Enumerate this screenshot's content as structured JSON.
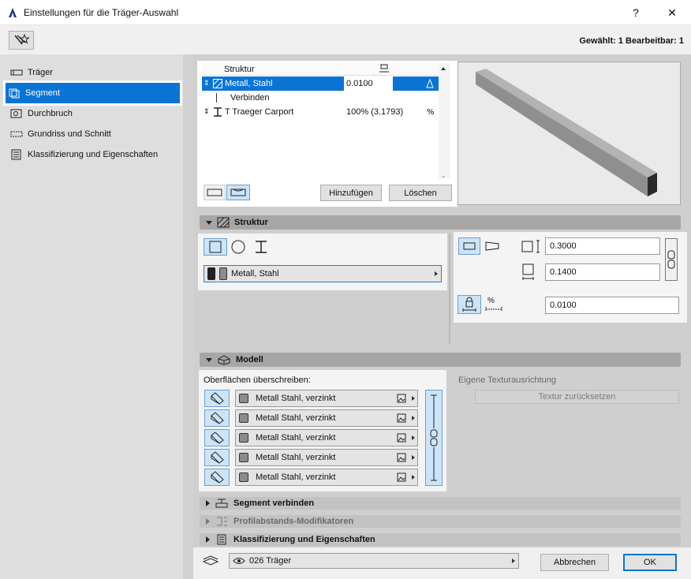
{
  "window": {
    "title": "Einstellungen für die Träger-Auswahl",
    "help": "?",
    "close": "✕"
  },
  "header": {
    "selection_info": "Gewählt: 1 Bearbeitbar: 1"
  },
  "sidebar": {
    "items": [
      {
        "label": "Träger"
      },
      {
        "label": "Segment"
      },
      {
        "label": "Durchbruch"
      },
      {
        "label": "Grundriss und Schnitt"
      },
      {
        "label": "Klassifizierung und Eigenschaften"
      }
    ]
  },
  "structure_table": {
    "header": "Struktur",
    "rows": [
      {
        "name": "Metall, Stahl",
        "value": "0.0100"
      },
      {
        "name": "Verbinden",
        "value": ""
      },
      {
        "name": "T Traeger Carport",
        "value": "100% (3.1793)"
      }
    ],
    "add_button": "Hinzufügen",
    "delete_button": "Löschen"
  },
  "sections": {
    "struktur": "Struktur",
    "modell": "Modell",
    "segment_verbinden": "Segment verbinden",
    "profil_mod": "Profilabstands-Modifikatoren",
    "klassifizierung": "Klassifizierung und Eigenschaften"
  },
  "struktur": {
    "material": "Metall, Stahl",
    "width": "0.3000",
    "height": "0.1400",
    "offset": "0.0100",
    "percent_icon": "%"
  },
  "modell": {
    "override_label": "Oberflächen überschreiben:",
    "surfaces": [
      "Metall Stahl, verzinkt",
      "Metall Stahl, verzinkt",
      "Metall Stahl, verzinkt",
      "Metall Stahl, verzinkt",
      "Metall Stahl, verzinkt"
    ],
    "texture_label": "Eigene Texturausrichtung",
    "texture_reset": "Textur zurücksetzen"
  },
  "footer": {
    "layer": "026 Träger",
    "cancel": "Abbrechen",
    "ok": "OK"
  },
  "colors": {
    "accent": "#0a74d4",
    "section_bg": "#a6a6a6"
  }
}
